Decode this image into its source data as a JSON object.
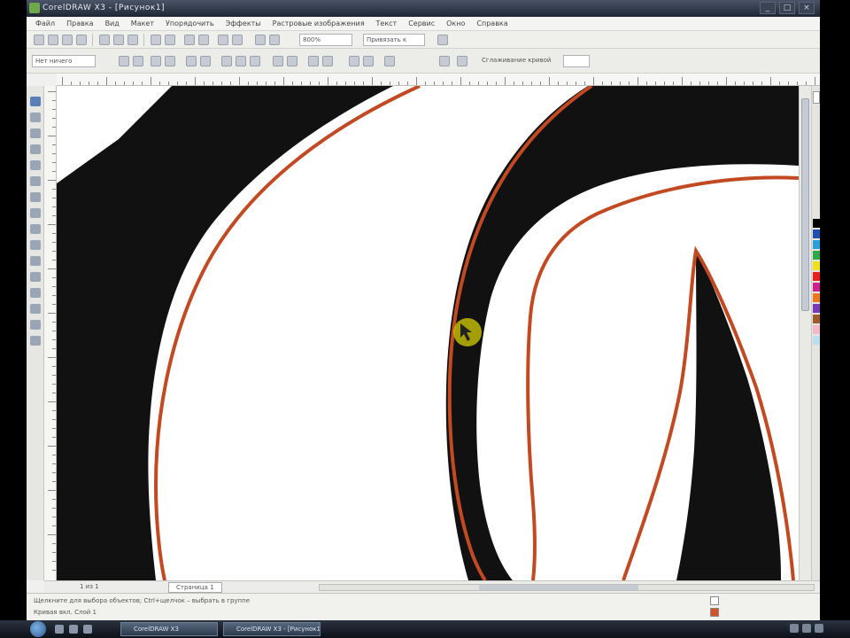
{
  "window": {
    "title": "CorelDRAW X3 - [Рисунок1]",
    "controls": [
      "_",
      "□",
      "×"
    ]
  },
  "menubar": {
    "items": [
      "Файл",
      "Правка",
      "Вид",
      "Макет",
      "Упорядочить",
      "Эффекты",
      "Растровые изображения",
      "Текст",
      "Сервис",
      "Окно",
      "Справка"
    ]
  },
  "standard_toolbar": {
    "zoom_value": "800%",
    "snap_label": "Привязать к"
  },
  "property_bar": {
    "preset_value": "Нет ничего",
    "smoothing_label": "Сглаживание кривой"
  },
  "document": {
    "page_label": "Страница 1",
    "page_counter": "1 из 1"
  },
  "statusbar": {
    "line1": "Щелкните для выбора объектов; Ctrl+щелчок – выбрать в группе",
    "line2": "Кривая вкл. Слой 1"
  },
  "taskbar": {
    "tasks": [
      "CorelDRAW X3",
      "CorelDRAW X3 - [Рисунок1]"
    ]
  },
  "colors": {
    "accent": "#d4542a",
    "outline": "#c24a22",
    "ink": "#111111",
    "cursor": "#c9c400"
  },
  "icons": {
    "app": "coreldraw-icon",
    "start": "windows-start-icon"
  }
}
